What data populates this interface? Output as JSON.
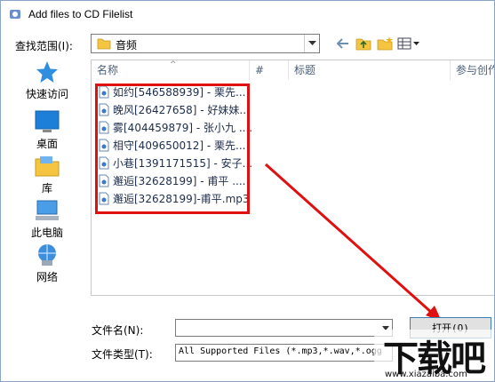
{
  "window": {
    "title": "Add files to CD Filelist"
  },
  "lookin": {
    "label": "查找范围(I):",
    "value": "音频"
  },
  "places": [
    {
      "label": "快速访问",
      "icon": "star-icon"
    },
    {
      "label": "桌面",
      "icon": "desktop-icon"
    },
    {
      "label": "库",
      "icon": "library-icon"
    },
    {
      "label": "此电脑",
      "icon": "computer-icon"
    },
    {
      "label": "网络",
      "icon": "network-icon"
    }
  ],
  "columns": [
    "名称",
    "#",
    "标题",
    "参与创作"
  ],
  "files": [
    "如约[546588939] - 栗先...",
    "晚风[26427658] - 好妹妹...",
    "雾[404459879] - 张小九 ....",
    "相守[409650012] - 栗先...",
    "小巷[1391171515] - 安子...",
    "邂逅[32628199] - 甫平 ....",
    "邂逅[32628199]-甫平.mp3"
  ],
  "filename": {
    "label": "文件名(N):",
    "value": ""
  },
  "filetype": {
    "label": "文件类型(T):",
    "value": "All Supported Files (*.mp3,*.wav,*.ogg"
  },
  "open_button": "打开(O)",
  "watermark": {
    "text": "下载吧",
    "url": "www.xiazaiba.com"
  },
  "colors": {
    "highlight_box": "#e01010",
    "arrow": "#e01010"
  }
}
